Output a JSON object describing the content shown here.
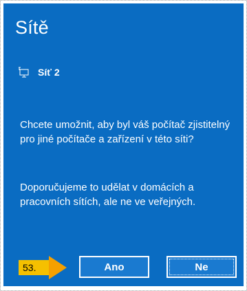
{
  "dialog": {
    "title": "Sítě",
    "network_icon": "network-ethernet-icon",
    "network_name": "Síť 2",
    "question": "Chcete umožnit, aby byl váš počítač zjistitelný pro jiné počítače a zařízení v této síti?",
    "advice": "Doporučujeme to udělat v domácích a pracovních sítích, ale ne ve veřejných.",
    "yes_label": "Ano",
    "no_label": "Ne"
  },
  "step_marker": {
    "label": "53."
  },
  "colors": {
    "panel_background": "#0a6cc2",
    "marker": "#f5c000",
    "text": "#ffffff"
  }
}
